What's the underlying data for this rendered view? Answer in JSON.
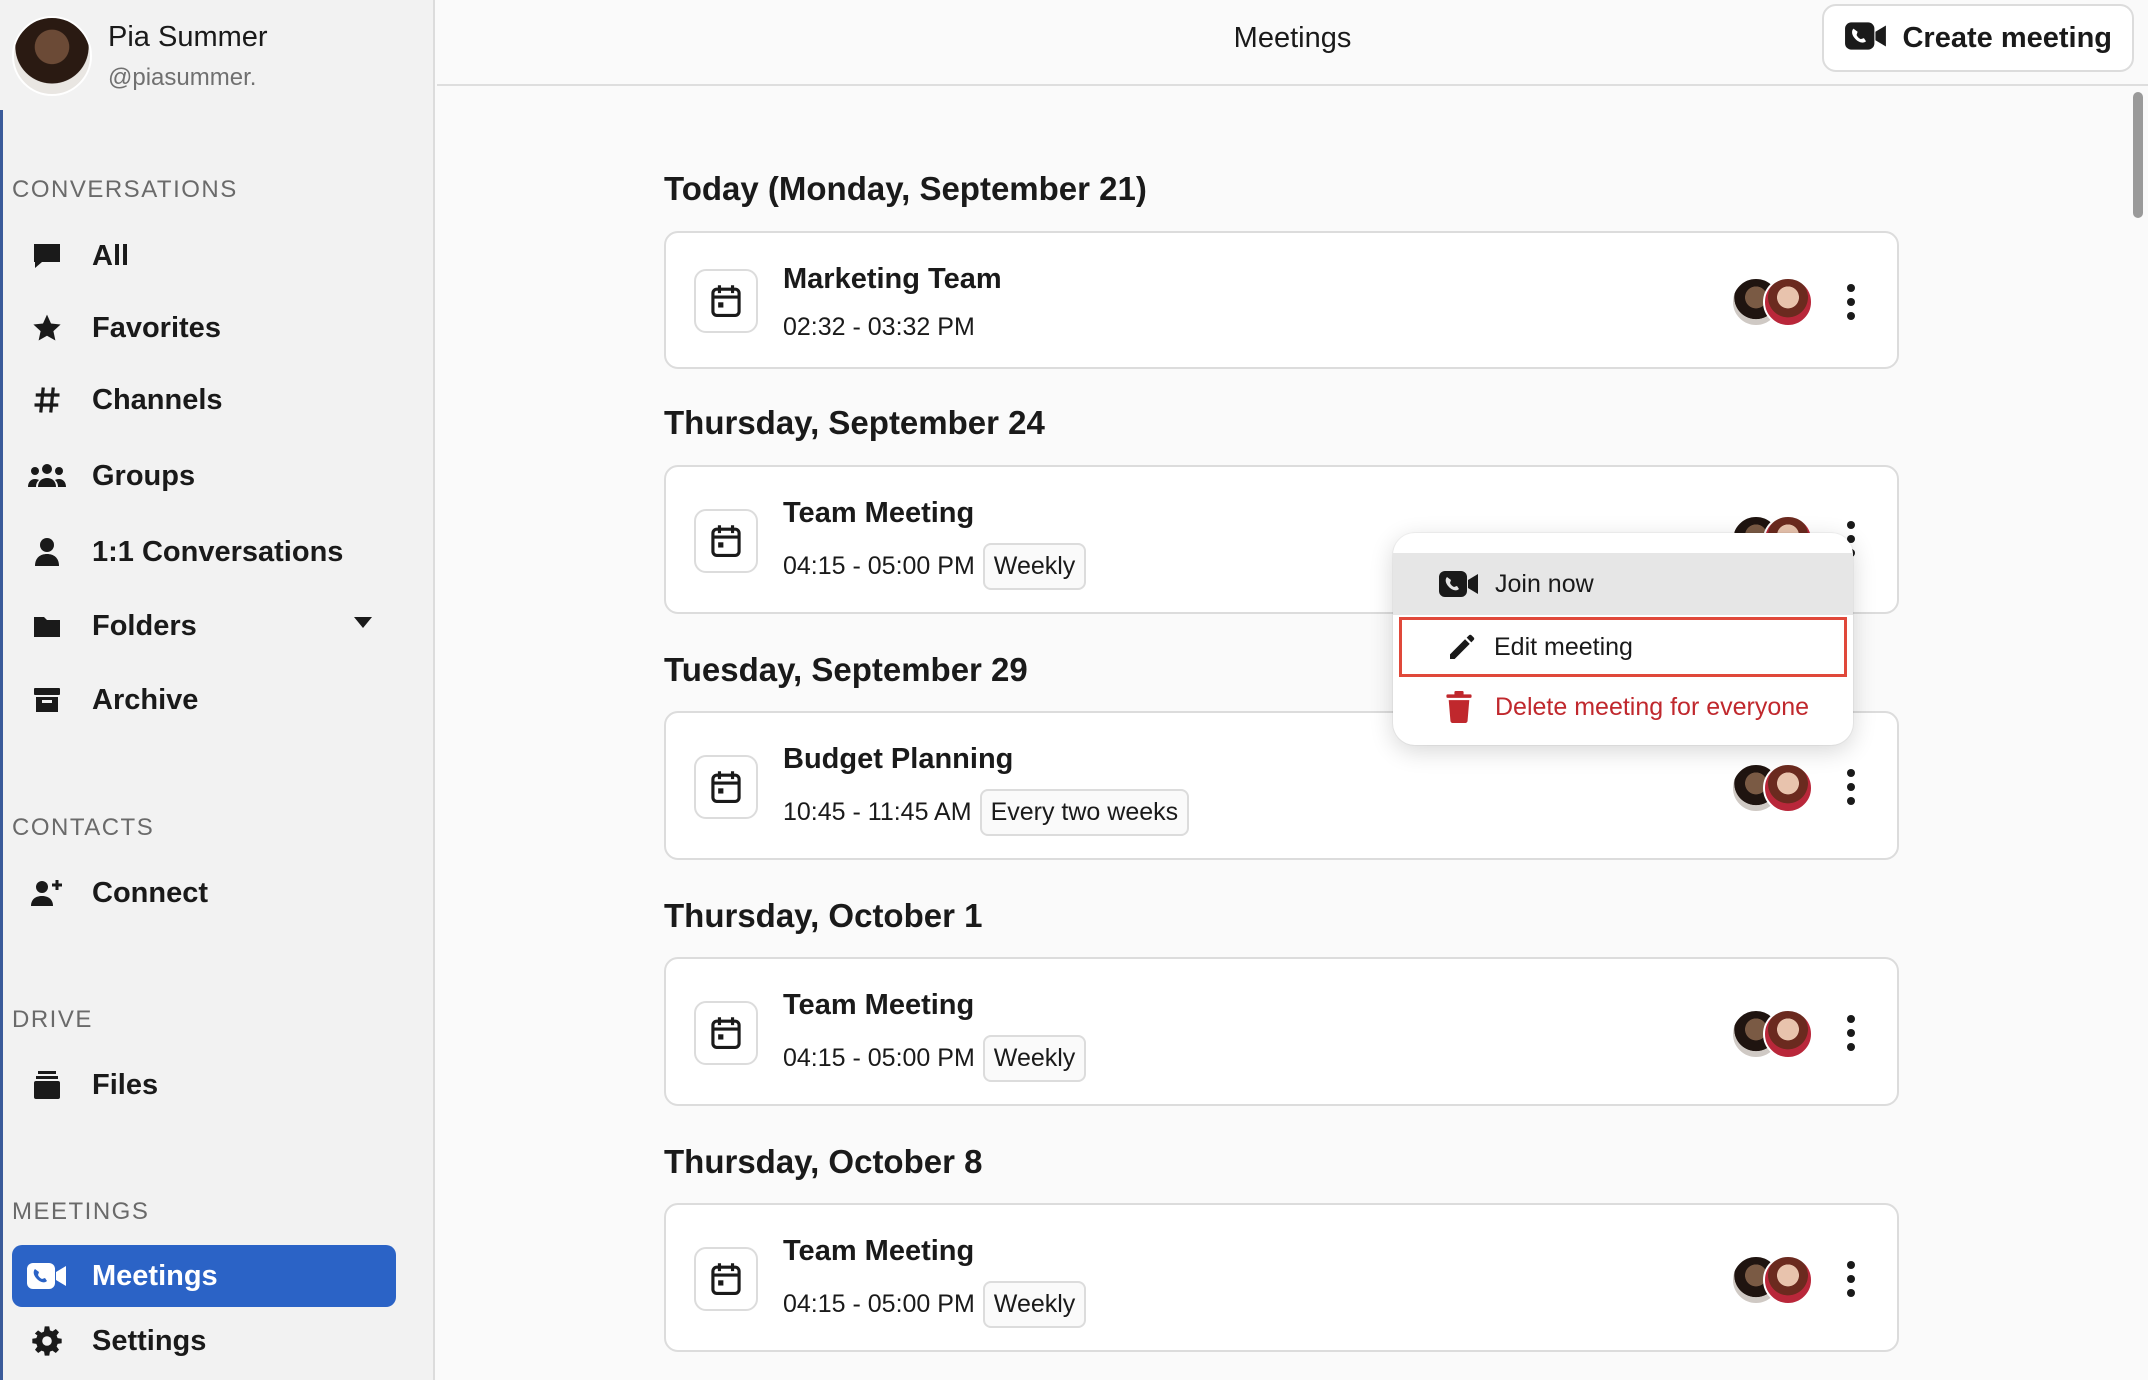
{
  "user": {
    "name": "Pia Summer",
    "handle": "@piasummer."
  },
  "sidebar": {
    "conversations_label": "CONVERSATIONS",
    "conversations": [
      {
        "label": "All",
        "icon": "chat-bubble-icon"
      },
      {
        "label": "Favorites",
        "icon": "star-icon"
      },
      {
        "label": "Channels",
        "icon": "hash-icon"
      },
      {
        "label": "Groups",
        "icon": "users-icon"
      },
      {
        "label": "1:1 Conversations",
        "icon": "user-icon"
      },
      {
        "label": "Folders",
        "icon": "folder-icon"
      },
      {
        "label": "Archive",
        "icon": "archive-icon"
      }
    ],
    "contacts_label": "CONTACTS",
    "contacts": [
      {
        "label": "Connect",
        "icon": "user-plus-icon"
      }
    ],
    "drive_label": "DRIVE",
    "drive": [
      {
        "label": "Files",
        "icon": "files-icon"
      }
    ],
    "meetings_label": "MEETINGS",
    "meetings": [
      {
        "label": "Meetings",
        "icon": "video-call-icon",
        "active": true
      },
      {
        "label": "Settings",
        "icon": "gear-icon"
      }
    ]
  },
  "header": {
    "title": "Meetings",
    "create_label": "Create meeting"
  },
  "days": [
    {
      "heading": "Today (Monday, September 21)",
      "meetings": [
        {
          "title": "Marketing Team",
          "time": "02:32 - 03:32 PM",
          "recurrence": ""
        }
      ]
    },
    {
      "heading": "Thursday, September 24",
      "meetings": [
        {
          "title": "Team Meeting",
          "time": "04:15 - 05:00 PM",
          "recurrence": "Weekly"
        }
      ]
    },
    {
      "heading": "Tuesday, September 29",
      "meetings": [
        {
          "title": "Budget Planning",
          "time": "10:45 - 11:45 AM",
          "recurrence": "Every two weeks"
        }
      ]
    },
    {
      "heading": "Thursday, October 1",
      "meetings": [
        {
          "title": "Team Meeting",
          "time": "04:15 - 05:00 PM",
          "recurrence": "Weekly"
        }
      ]
    },
    {
      "heading": "Thursday, October 8",
      "meetings": [
        {
          "title": "Team Meeting",
          "time": "04:15 - 05:00 PM",
          "recurrence": "Weekly"
        }
      ]
    }
  ],
  "context_menu": {
    "items": [
      {
        "label": "Join now",
        "icon": "video-call-icon"
      },
      {
        "label": "Edit meeting",
        "icon": "pencil-icon"
      },
      {
        "label": "Delete meeting for everyone",
        "icon": "trash-icon"
      }
    ]
  },
  "colors": {
    "accent": "#2b63c6",
    "danger": "#c0282d",
    "focus_ring": "#e0483a"
  }
}
